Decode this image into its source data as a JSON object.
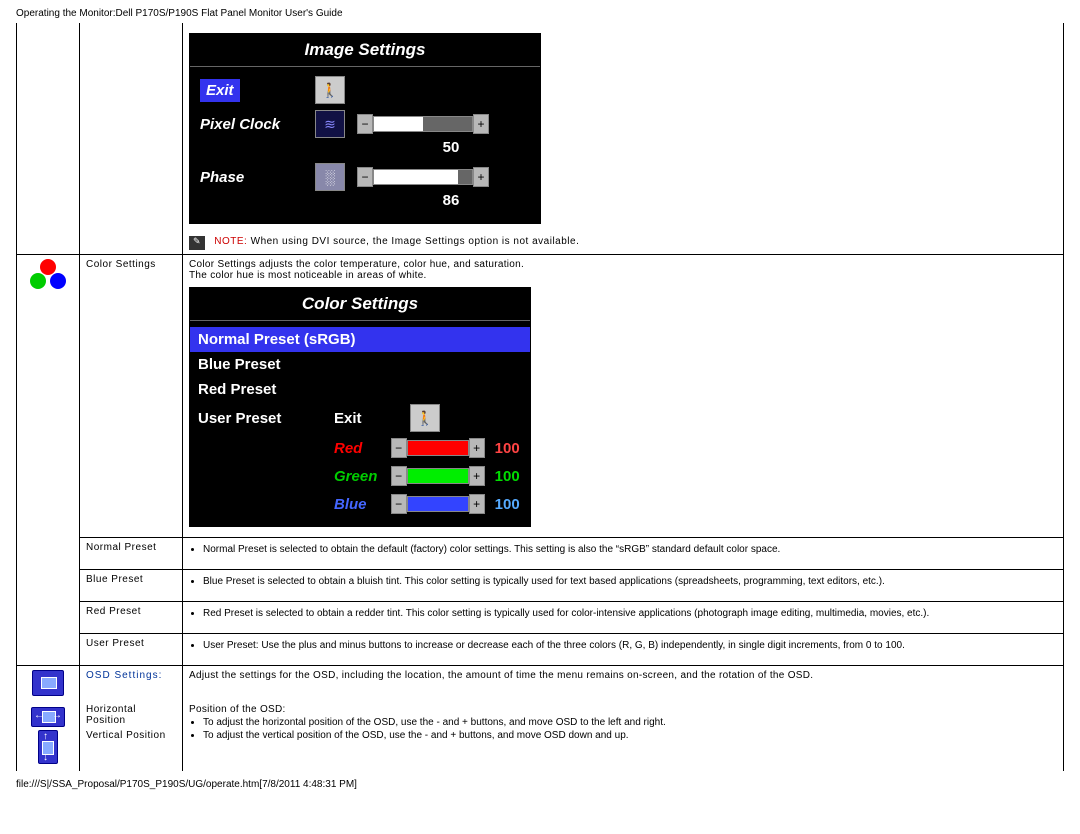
{
  "header": "Operating the Monitor:Dell P170S/P190S Flat Panel Monitor User's Guide",
  "footer": "file:///S|/SSA_Proposal/P170S_P190S/UG/operate.htm[7/8/2011 4:48:31 PM]",
  "imgSettings": {
    "title": "Image Settings",
    "exit": "Exit",
    "pixelClock": {
      "label": "Pixel Clock",
      "value": "50"
    },
    "phase": {
      "label": "Phase",
      "value": "86"
    },
    "notePrefix": "NOTE:",
    "note": "When using DVI source, the Image Settings option is not available."
  },
  "colorSettings": {
    "rowLabel": "Color Settings",
    "desc1": "Color Settings adjusts the color temperature, color hue, and saturation.",
    "desc2": "The color hue is most noticeable in areas of white.",
    "panel": {
      "title": "Color Settings",
      "normal": "Normal Preset (sRGB)",
      "blue": "Blue Preset",
      "red": "Red Preset",
      "user": "User Preset",
      "exit": "Exit",
      "redRow": {
        "label": "Red",
        "value": "100"
      },
      "greenRow": {
        "label": "Green",
        "value": "100"
      },
      "blueRow": {
        "label": "Blue",
        "value": "100"
      }
    }
  },
  "presets": {
    "normal": {
      "label": "Normal Preset",
      "bullet": "Normal Preset is selected to obtain the default (factory) color settings. This setting is also the “sRGB” standard default color space."
    },
    "blue": {
      "label": "Blue Preset",
      "bullet": "Blue Preset is selected to obtain a bluish tint. This color setting is typically used for text based applications (spreadsheets, programming, text editors, etc.)."
    },
    "red": {
      "label": "Red Preset",
      "bullet": "Red Preset is selected to obtain a redder tint. This color setting is typically used for color-intensive applications (photograph image editing, multimedia, movies, etc.)."
    },
    "user": {
      "label": "User Preset",
      "bullet": "User Preset: Use the plus and minus buttons to increase or decrease each of the three colors (R, G, B) independently, in single digit increments, from 0 to 100."
    }
  },
  "osd": {
    "label": "OSD Settings:",
    "desc": "Adjust the settings for the OSD, including the location, the amount of time the menu remains on-screen, and the rotation of the OSD.",
    "hpos": {
      "label": "Horizontal Position"
    },
    "vpos": {
      "label": "Vertical Position"
    },
    "posHeading": "Position of the OSD:",
    "b1": "To adjust the horizontal position of the OSD, use the - and + buttons, and move OSD to the left and right.",
    "b2": "To adjust the vertical position of the OSD, use the - and + buttons, and move OSD down and up."
  }
}
